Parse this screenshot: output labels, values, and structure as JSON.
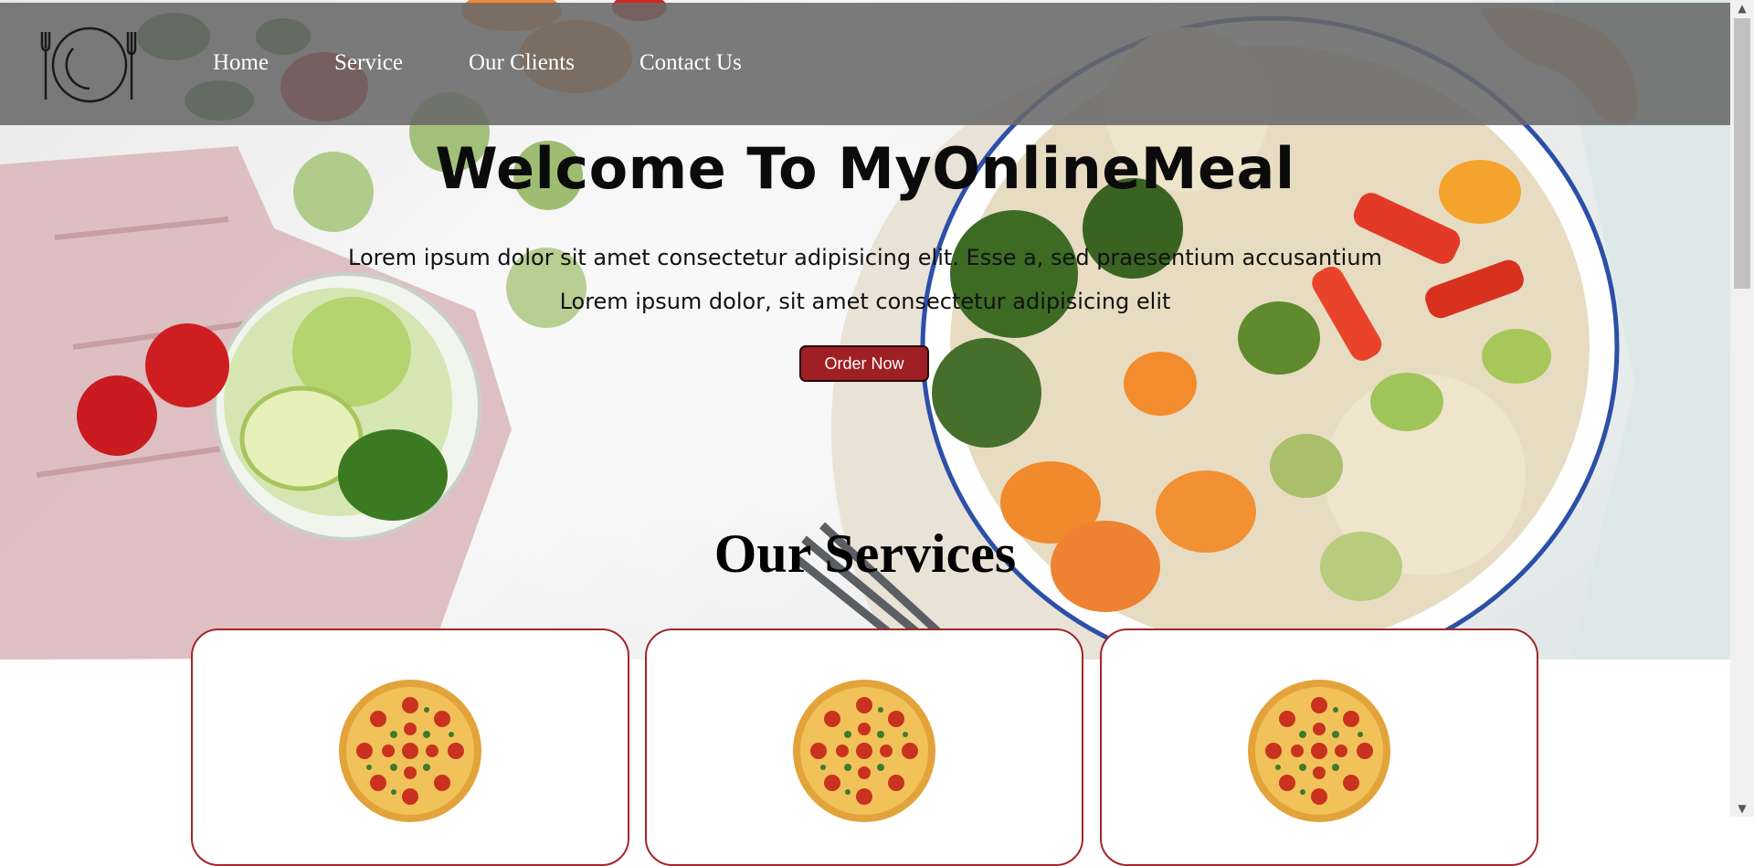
{
  "nav": {
    "links": [
      {
        "label": "Home"
      },
      {
        "label": "Service"
      },
      {
        "label": "Our Clients"
      },
      {
        "label": "Contact Us"
      }
    ]
  },
  "hero": {
    "title": "Welcome To MyOnlineMeal",
    "line1": "Lorem ipsum dolor sit amet consectetur adipisicing elit. Esse a, sed praesentium accusantium",
    "line2": "Lorem ipsum dolor, sit amet consectetur adipisicing elit",
    "button_label": "Order Now"
  },
  "services": {
    "title": "Our Services",
    "cards": [
      {
        "image": "pizza-image"
      },
      {
        "image": "pizza-image"
      },
      {
        "image": "pizza-image"
      }
    ]
  },
  "colors": {
    "accent": "#9e1f24",
    "nav_bg": "#696969",
    "card_border": "#a3262b"
  }
}
